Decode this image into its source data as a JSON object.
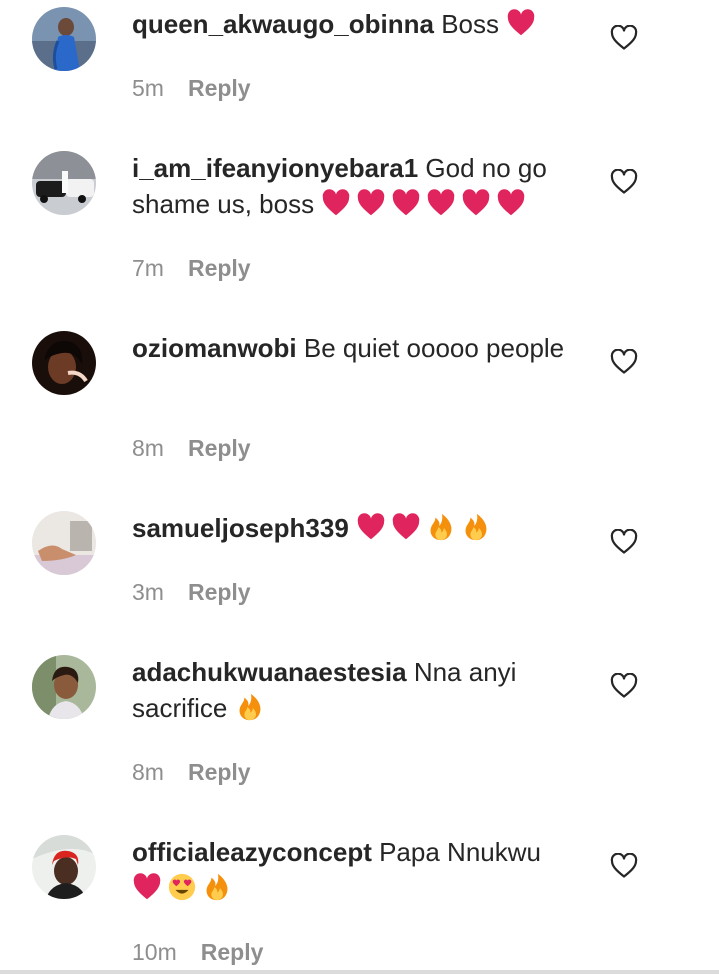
{
  "comments": [
    {
      "username": "queen_akwaugo_obinna",
      "text": "Boss",
      "emojis": [
        "heart"
      ],
      "time": "5m",
      "reply_label": "Reply"
    },
    {
      "username": "i_am_ifeanyionyebara1",
      "text": "God no go shame us, boss",
      "emojis": [
        "heart",
        "heart",
        "heart",
        "heart",
        "heart",
        "heart"
      ],
      "time": "7m",
      "reply_label": "Reply"
    },
    {
      "username": "oziomanwobi",
      "text": "Be quiet ooooo people",
      "emojis": [],
      "time": "8m",
      "reply_label": "Reply"
    },
    {
      "username": "samueljoseph339",
      "text": "",
      "emojis": [
        "heart",
        "heart",
        "fire",
        "fire"
      ],
      "time": "3m",
      "reply_label": "Reply"
    },
    {
      "username": "adachukwuanaestesia",
      "text": "Nna anyi sacrifice",
      "emojis": [
        "fire"
      ],
      "time": "8m",
      "reply_label": "Reply"
    },
    {
      "username": "officialeazyconcept",
      "text": "Papa Nnukwu",
      "emojis": [
        "heart",
        "heart-eyes",
        "fire"
      ],
      "time": "10m",
      "reply_label": "Reply"
    }
  ],
  "icons": {
    "like": "heart-outline-icon",
    "emoji_heart": "red-heart-emoji",
    "emoji_fire": "fire-emoji",
    "emoji_heart_eyes": "heart-eyes-emoji"
  },
  "colors": {
    "text": "#262626",
    "meta": "#8e8e8e",
    "emoji_heart": "#e0245e"
  }
}
